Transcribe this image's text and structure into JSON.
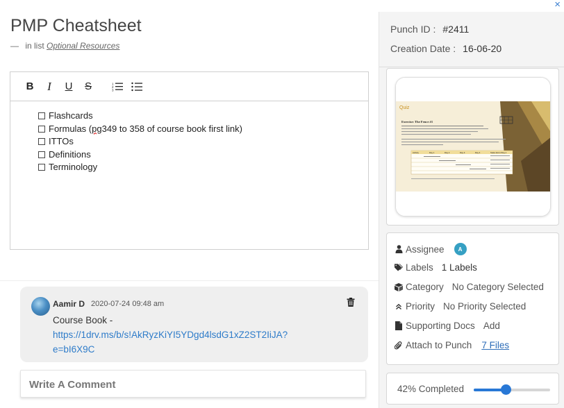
{
  "close_label": "×",
  "title": "PMP Cheatsheet",
  "subtitle": {
    "dash": "—",
    "prefix": "in list",
    "list_name": "Optional Resources"
  },
  "editor": {
    "toolbar": {
      "bold": "B",
      "italic": "I",
      "underline": "U",
      "strike": "S"
    },
    "items": [
      {
        "text": "Flashcards"
      },
      {
        "pre": "Formulas (",
        "spell": "pg",
        "post": " 349 to 358 of course book first link)"
      },
      {
        "text": "ITTOs"
      },
      {
        "text": "Definitions"
      },
      {
        "text": "Terminology"
      }
    ]
  },
  "comment": {
    "author": "Aamir D",
    "date": "2020-07-24 09:48 am",
    "text": "Course Book -",
    "link": "https://1drv.ms/b/s!AkRyzKiYI5YDgd4lsdG1xZ2ST2IiJA?e=bI6X9C"
  },
  "write_comment_placeholder": "Write A Comment",
  "meta": {
    "punch_id_label": "Punch ID :",
    "punch_id_value": "#2411",
    "creation_label": "Creation Date :",
    "creation_value": "16-06-20"
  },
  "attachment_preview": {
    "heading": "Quiz",
    "exercise": "Exercise: The Fence #1",
    "columns": [
      "Activity",
      "Day 1",
      "Day 2",
      "Day 3",
      "Day 4",
      "Status End of Day 4"
    ]
  },
  "props": {
    "assignee_label": "Assignee",
    "assignee_initial": "A",
    "labels_label": "Labels",
    "labels_value": "1 Labels",
    "category_label": "Category",
    "category_value": "No Category Selected",
    "priority_label": "Priority",
    "priority_value": "No Priority Selected",
    "docs_label": "Supporting Docs",
    "docs_value": "Add",
    "attach_label": "Attach to Punch",
    "attach_value": "7 Files"
  },
  "progress": {
    "label": "42% Completed",
    "value": 0.42
  },
  "colors": {
    "accent": "#2878d6",
    "link": "#2d7bc9",
    "badge": "#36a0c3"
  }
}
